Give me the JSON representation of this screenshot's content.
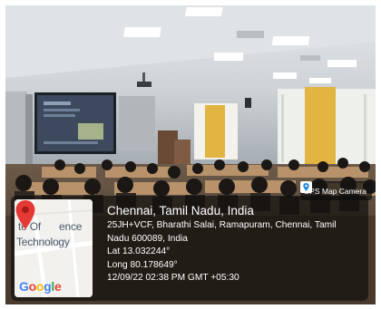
{
  "badge": {
    "text": "GPS Map Camera",
    "icon": "map-pin-icon"
  },
  "location": {
    "place": "Chennai, Tamil Nadu, India",
    "address_line1": "25JH+VCF, Bharathi Salai, Ramapuram, Chennai, Tamil",
    "address_line2": "Nadu 600089, India",
    "lat": "Lat 13.032244°",
    "long": "Long 80.178649°",
    "datetime": "12/09/22 02:38 PM GMT +05:30"
  },
  "map": {
    "label_line1": "te Of",
    "label_fragment": "ence",
    "label_line2": "Technology",
    "logo": [
      "G",
      "o",
      "o",
      "g",
      "l",
      "e"
    ]
  },
  "scene": {
    "projector_slide_color": "#3d4a5e",
    "wall_color": "#d9dde0",
    "accent_wall": "#e2b441",
    "seat_color": "#b8926a"
  }
}
